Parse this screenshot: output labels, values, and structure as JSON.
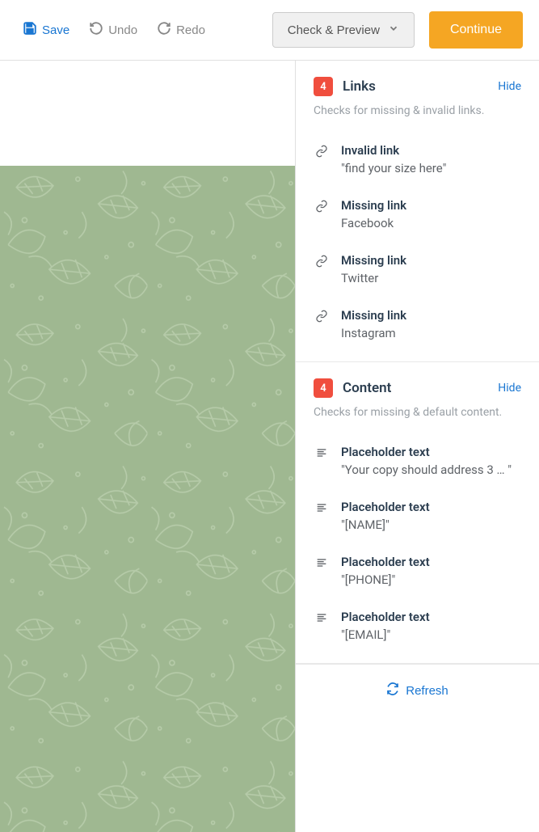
{
  "toolbar": {
    "save": "Save",
    "undo": "Undo",
    "redo": "Redo",
    "check_preview": "Check & Preview",
    "continue": "Continue"
  },
  "sections": {
    "links": {
      "count": "4",
      "title": "Links",
      "hide": "Hide",
      "desc": "Checks for missing & invalid links.",
      "items": [
        {
          "title": "Invalid link",
          "detail": "\"find your size here\""
        },
        {
          "title": "Missing link",
          "detail": "Facebook"
        },
        {
          "title": "Missing link",
          "detail": "Twitter"
        },
        {
          "title": "Missing link",
          "detail": "Instagram"
        }
      ]
    },
    "content": {
      "count": "4",
      "title": "Content",
      "hide": "Hide",
      "desc": "Checks for missing & default content.",
      "items": [
        {
          "title": "Placeholder text",
          "detail": "\"Your copy should address 3 … \""
        },
        {
          "title": "Placeholder text",
          "detail": "\"[NAME]\""
        },
        {
          "title": "Placeholder text",
          "detail": "\"[PHONE]\""
        },
        {
          "title": "Placeholder text",
          "detail": "\"[EMAIL]\""
        }
      ]
    }
  },
  "refresh": "Refresh"
}
